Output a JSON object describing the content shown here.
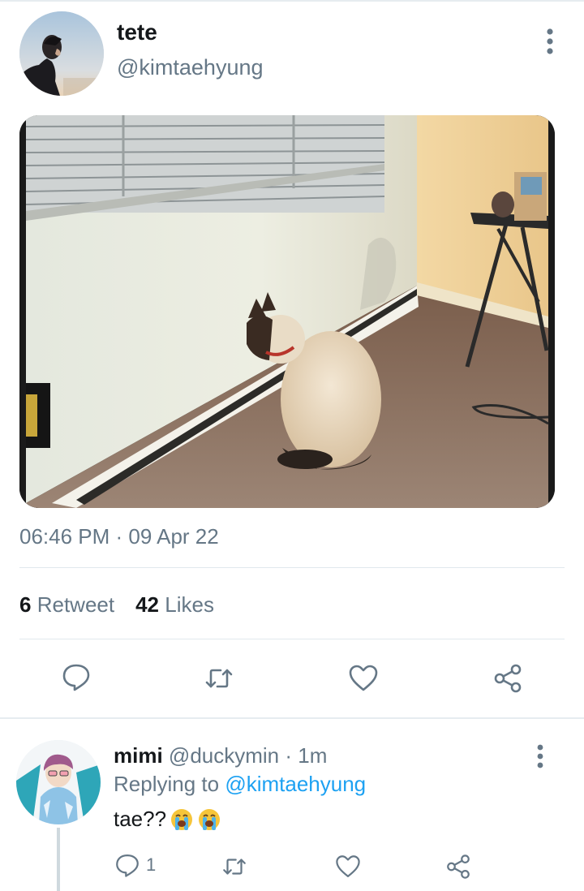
{
  "tweet": {
    "display_name": "tete",
    "handle": "@kimtaehyung",
    "timestamp": "06:46 PM · 09 Apr 22",
    "retweet_count": "6",
    "retweet_label": "Retweet",
    "likes_count": "42",
    "likes_label": "Likes",
    "icons": [
      "reply-icon",
      "retweet-icon",
      "like-icon",
      "share-icon",
      "more-options-icon"
    ]
  },
  "reply": {
    "display_name": "mimi",
    "handle": "@duckymin",
    "time": "· 1m",
    "replying_prefix": "Replying to",
    "replying_handle": "@kimtaehyung",
    "text": "tae??",
    "emoji": [
      "loudly-crying-face-emoji",
      "loudly-crying-face-emoji"
    ],
    "reply_count": "1",
    "icons": [
      "reply-icon",
      "retweet-icon",
      "like-icon",
      "share-icon",
      "more-options-icon"
    ]
  },
  "colors": {
    "accent": "#1da1f2",
    "secondary_text": "#657786",
    "primary_text": "#14171a",
    "divider": "#e1e8ed"
  }
}
